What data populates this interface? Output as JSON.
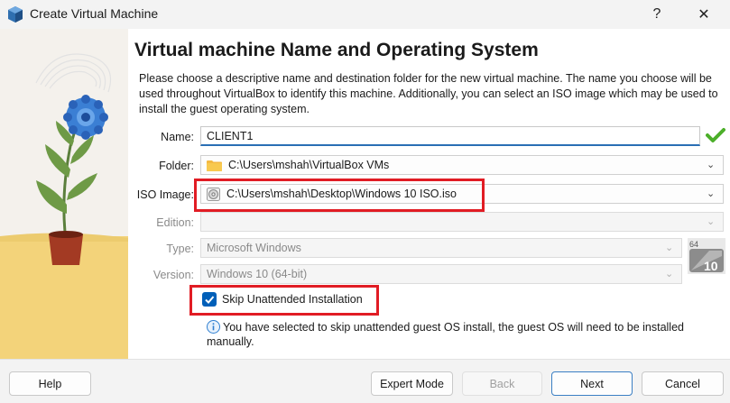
{
  "window": {
    "title": "Create Virtual Machine",
    "help_symbol": "?",
    "close_symbol": "✕"
  },
  "heading": "Virtual machine Name and Operating System",
  "description": "Please choose a descriptive name and destination folder for the new virtual machine. The name you choose will be used throughout VirtualBox to identify this machine. Additionally, you can select an ISO image which may be used to install the guest operating system.",
  "form": {
    "name": {
      "label": "Name:",
      "value": "CLIENT1"
    },
    "folder": {
      "label": "Folder:",
      "value": "C:\\Users\\mshah\\VirtualBox VMs"
    },
    "iso": {
      "label": "ISO Image:",
      "value": "C:\\Users\\mshah\\Desktop\\Windows 10 ISO.iso"
    },
    "edition": {
      "label": "Edition:",
      "value": ""
    },
    "type": {
      "label": "Type:",
      "value": "Microsoft Windows"
    },
    "version": {
      "label": "Version:",
      "value": "Windows 10 (64-bit)"
    },
    "os_badge": {
      "bits": "64",
      "version": "10"
    }
  },
  "skip_unattended": {
    "label": "Skip Unattended Installation",
    "checked": true
  },
  "info_message": "You have selected to skip unattended guest OS install, the guest OS will need to be installed manually.",
  "buttons": {
    "help": "Help",
    "expert": "Expert Mode",
    "back": "Back",
    "next": "Next",
    "cancel": "Cancel"
  },
  "colors": {
    "accent": "#005fb8",
    "highlight": "#e11c24",
    "valid": "#4caf2a"
  }
}
